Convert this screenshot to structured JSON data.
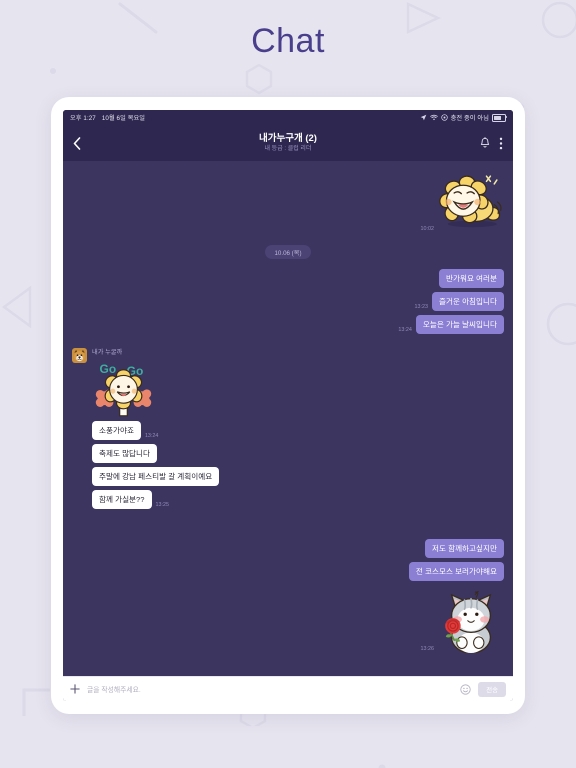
{
  "page": {
    "title": "Chat",
    "accent_color": "#4a3f8c",
    "background_color": "#e6e4ee"
  },
  "device": {
    "screen_bg": "#3b3560",
    "header_bg": "#2e2850"
  },
  "statusbar": {
    "time": "오후 1:27",
    "date": "10월 6일 목요일",
    "battery_text": "충전 중이 아님",
    "icons": {
      "location": "location-arrow-icon",
      "wifi": "wifi-icon",
      "rotation_lock": "rotation-lock-icon",
      "battery": "battery-icon"
    }
  },
  "header": {
    "back": "back-chevron-icon",
    "title": "내가누구개 (2)",
    "subtitle": "내 등급 : 클럽 리더",
    "alarm_icon": "alarm-bell-icon",
    "menu_icon": "more-vertical-icon"
  },
  "divider": {
    "label": "10.06 (목)"
  },
  "sender": {
    "name": "내가 누굴까",
    "avatar": "dog-avatar"
  },
  "messages": [
    {
      "side": "right",
      "type": "sticker",
      "sticker": "lion-laughing-sticker",
      "time": "10:02"
    },
    {
      "side": "right",
      "type": "text",
      "text": "반가워요 여러분",
      "time": ""
    },
    {
      "side": "right",
      "type": "text",
      "text": "즐거운 아침입니다",
      "time": "13:23"
    },
    {
      "side": "right",
      "type": "text",
      "text": "오늘은 가늘 날씨입니다",
      "time": "13:24"
    },
    {
      "side": "left",
      "type": "sticker",
      "sticker": "lion-cheer-gogo-sticker",
      "time": ""
    },
    {
      "side": "left",
      "type": "text",
      "text": "소풍가야죠",
      "time": "13:24"
    },
    {
      "side": "left",
      "type": "text",
      "text": "축제도 많답니다",
      "time": ""
    },
    {
      "side": "left",
      "type": "text",
      "text": "주말에 강남 페스티발 갈 계획이예요",
      "time": ""
    },
    {
      "side": "left",
      "type": "text",
      "text": "함께 가실분??",
      "time": "13:25"
    },
    {
      "side": "right",
      "type": "text",
      "text": "저도 함께하고싶지만",
      "time": ""
    },
    {
      "side": "right",
      "type": "text",
      "text": "전 코스모스 보러가야해요",
      "time": ""
    },
    {
      "side": "right",
      "type": "sticker",
      "sticker": "cat-with-rose-sticker",
      "time": "13:26"
    }
  ],
  "sticker_text": {
    "go_left": "Go",
    "go_right": "Go"
  },
  "input": {
    "add_icon": "plus-icon",
    "placeholder": "글을 작성해주세요.",
    "emoji_icon": "emoji-smile-icon",
    "send_label": "전송"
  },
  "colors": {
    "outgoing_bubble": "#8b7fd4",
    "incoming_bubble": "#ffffff",
    "timestamp": "#938ab8",
    "divider_bg": "#4a4374"
  }
}
